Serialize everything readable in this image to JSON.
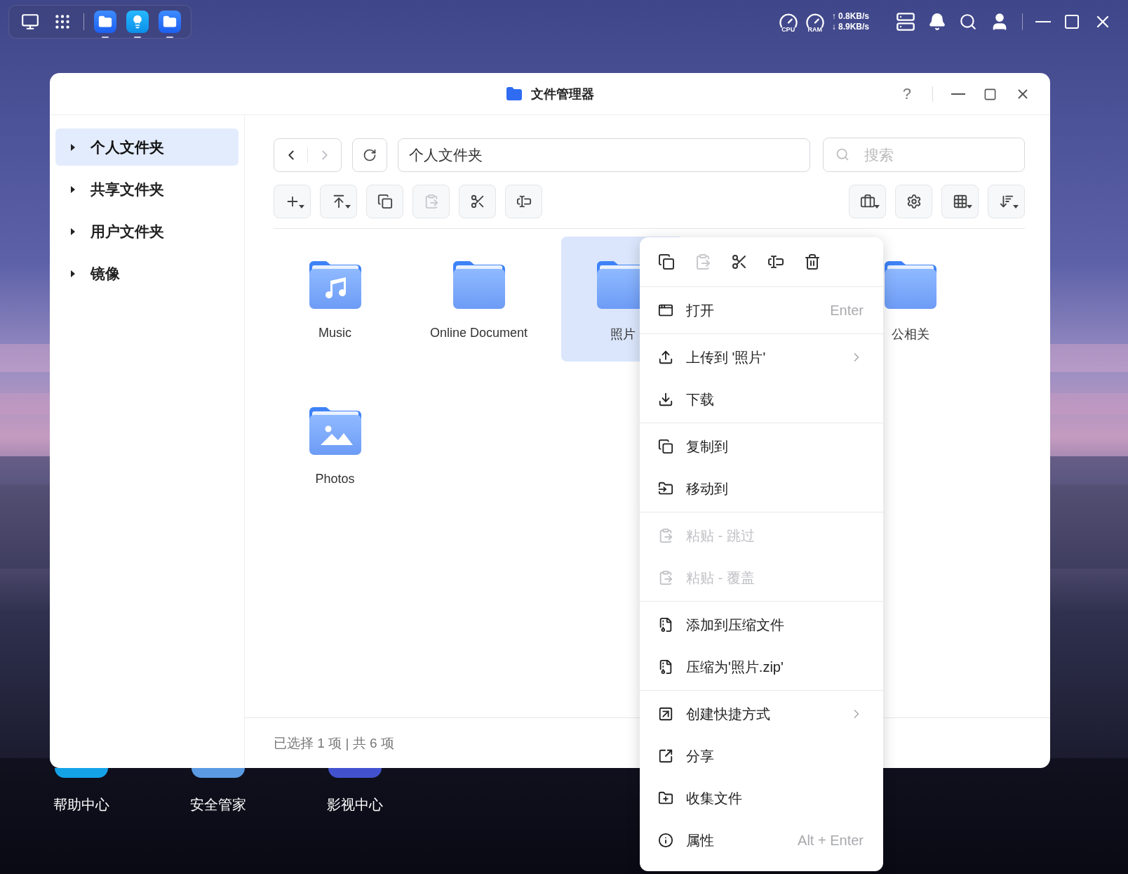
{
  "taskbar": {
    "apps": [
      {
        "kind": "files",
        "running": true
      },
      {
        "kind": "tips",
        "running": true
      },
      {
        "kind": "files",
        "running": true
      }
    ]
  },
  "status_area": {
    "cpu_label": "CPU",
    "ram_label": "RAM",
    "upload": "↑ 0.8KB/s",
    "download": "↓ 8.9KB/s"
  },
  "desktop_icons": [
    {
      "label": "帮助中心",
      "color": "#15a3e8"
    },
    {
      "label": "安全管家",
      "color": "#5a9be3"
    },
    {
      "label": "影视中心",
      "color": "#4252cf"
    }
  ],
  "window": {
    "title": "文件管理器",
    "help": "?"
  },
  "sidebar": {
    "items": [
      {
        "label": "个人文件夹",
        "selected": true
      },
      {
        "label": "共享文件夹",
        "selected": false
      },
      {
        "label": "用户文件夹",
        "selected": false
      },
      {
        "label": "镜像",
        "selected": false
      }
    ]
  },
  "nav": {
    "back_disabled": false,
    "forward_disabled": true
  },
  "path": {
    "value": "个人文件夹"
  },
  "search": {
    "placeholder": "搜索"
  },
  "toolbar": {
    "left": [
      {
        "kind": "new",
        "disabled": false
      },
      {
        "kind": "upload",
        "disabled": false
      },
      {
        "kind": "copy",
        "disabled": false
      },
      {
        "kind": "paste",
        "disabled": true
      },
      {
        "kind": "cut",
        "disabled": false
      },
      {
        "kind": "rename",
        "disabled": false
      }
    ],
    "right": [
      {
        "kind": "tools"
      },
      {
        "kind": "settings"
      },
      {
        "kind": "view"
      },
      {
        "kind": "sort"
      }
    ]
  },
  "files": [
    {
      "name": "Music",
      "kind": "music",
      "selected": false
    },
    {
      "name": "Online Document",
      "kind": "folder",
      "selected": false
    },
    {
      "name": "照片",
      "kind": "folder",
      "selected": true
    },
    {
      "name": "公相关",
      "kind": "folder",
      "selected": false
    },
    {
      "name": "Photos",
      "kind": "photos",
      "selected": false
    }
  ],
  "status_bar": "已选择 1 项 | 共 6 项",
  "context_menu": {
    "quick_actions": [
      {
        "kind": "copy",
        "disabled": false
      },
      {
        "kind": "paste",
        "disabled": true
      },
      {
        "kind": "cut",
        "disabled": false
      },
      {
        "kind": "rename",
        "disabled": false
      },
      {
        "kind": "delete",
        "disabled": false
      }
    ],
    "groups": [
      {
        "items": [
          {
            "kind": "open",
            "label": "打开",
            "shortcut": "Enter",
            "submenu": false,
            "disabled": false
          }
        ]
      },
      {
        "items": [
          {
            "kind": "upload",
            "label": "上传到 '照片'",
            "submenu": true,
            "disabled": false
          },
          {
            "kind": "download",
            "label": "下载",
            "submenu": false,
            "disabled": false
          }
        ]
      },
      {
        "items": [
          {
            "kind": "copy_to",
            "label": "复制到",
            "submenu": false,
            "disabled": false
          },
          {
            "kind": "move_to",
            "label": "移动到",
            "submenu": false,
            "disabled": false
          }
        ]
      },
      {
        "items": [
          {
            "kind": "paste",
            "label": "粘贴 - 跳过",
            "submenu": false,
            "disabled": true
          },
          {
            "kind": "paste",
            "label": "粘贴 - 覆盖",
            "submenu": false,
            "disabled": true
          }
        ]
      },
      {
        "items": [
          {
            "kind": "archive",
            "label": "添加到压缩文件",
            "submenu": false,
            "disabled": false
          },
          {
            "kind": "archive",
            "label": "压缩为'照片.zip'",
            "submenu": false,
            "disabled": false
          }
        ]
      },
      {
        "items": [
          {
            "kind": "shortcut",
            "label": "创建快捷方式",
            "submenu": true,
            "disabled": false
          },
          {
            "kind": "share",
            "label": "分享",
            "submenu": false,
            "disabled": false
          },
          {
            "kind": "collect",
            "label": "收集文件",
            "submenu": false,
            "disabled": false
          },
          {
            "kind": "info",
            "label": "属性",
            "shortcut": "Alt + Enter",
            "submenu": false,
            "disabled": false
          }
        ]
      }
    ]
  }
}
